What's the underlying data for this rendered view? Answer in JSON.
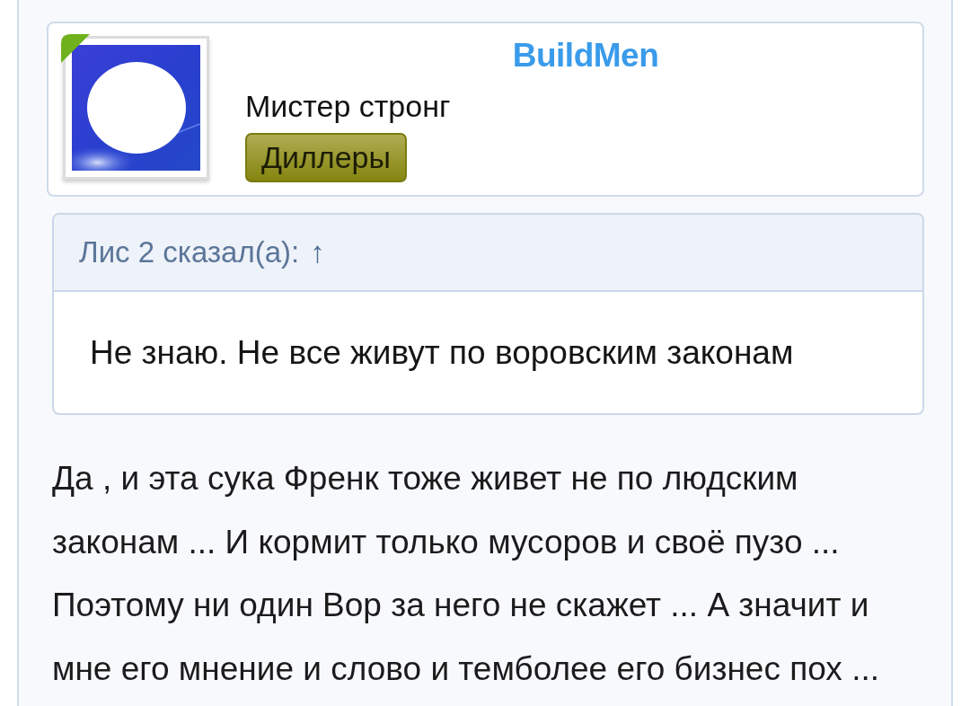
{
  "user_card": {
    "username": "BuildMen",
    "online": true,
    "user_title": "Мистер стронг",
    "group_badge": "Диллеры"
  },
  "quote": {
    "attribution": "Лис 2 сказал(а):",
    "jump_link": "↑",
    "text": "Не знаю. Не все живут по воровским законам"
  },
  "post": {
    "text": "Да , и эта сука Френк тоже живет не по людским законам ... И кормит только мусоров и своё пузо ... Поэтому ни один Вор за него не скажет ... А значит и мне его мнение и слово и темболее его бизнес пох ..."
  }
}
